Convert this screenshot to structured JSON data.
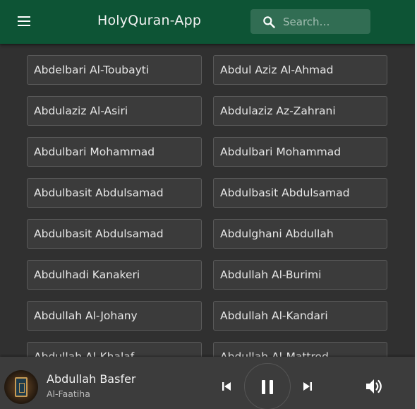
{
  "header": {
    "title": "HolyQuran-App",
    "search_placeholder": "Search…"
  },
  "reciters": [
    "Abdelbari Al-Toubayti",
    "Abdul Aziz Al-Ahmad",
    "Abdulaziz Al-Asiri",
    "Abdulaziz Az-Zahrani",
    "Abdulbari Mohammad",
    "Abdulbari Mohammad",
    "Abdulbasit Abdulsamad",
    "Abdulbasit Abdulsamad",
    "Abdulbasit Abdulsamad",
    "Abdulghani Abdullah",
    "Abdulhadi Kanakeri",
    "Abdullah Al-Burimi",
    "Abdullah Al-Johany",
    "Abdullah Al-Kandari",
    "Abdullah Al-Khalaf",
    "Abdullah Al-Mattrod"
  ],
  "player": {
    "reciter": "Abdullah Basfer",
    "surah": "Al-Faatiha",
    "state": "playing"
  },
  "colors": {
    "appbar": "#0d5435",
    "background": "#303030",
    "card": "#3b3b3b",
    "player": "#3c3c3c"
  },
  "icons": [
    "menu-icon",
    "search-icon",
    "skip-previous-icon",
    "pause-icon",
    "skip-next-icon",
    "volume-icon"
  ]
}
